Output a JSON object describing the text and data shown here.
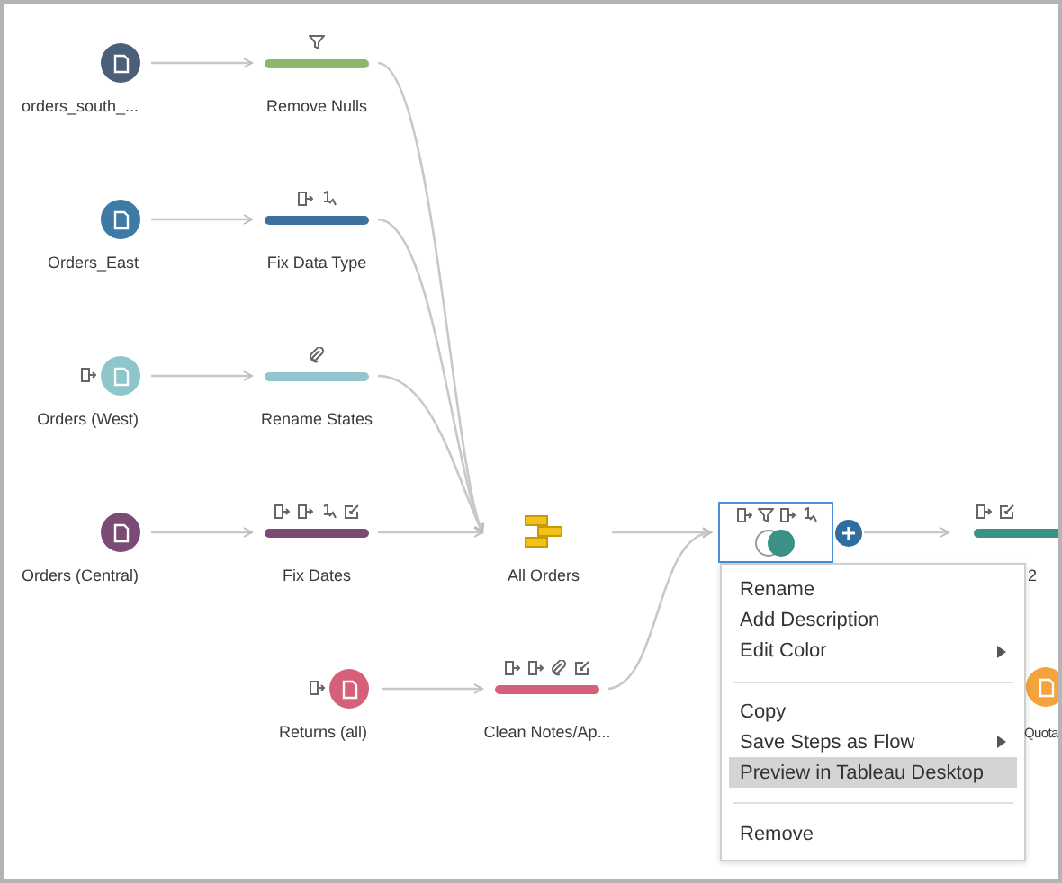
{
  "sources": [
    {
      "label": "orders_south_...",
      "color": "#4b5f78"
    },
    {
      "label": "Orders_East",
      "color": "#3d7aa6"
    },
    {
      "label": "Orders (West)",
      "color": "#8fc6cc"
    },
    {
      "label": "Orders (Central)",
      "color": "#7b4b76"
    },
    {
      "label": "Returns (all)",
      "color": "#d6607a"
    },
    {
      "label": "Quota",
      "color": "#f5a33c"
    }
  ],
  "steps": [
    {
      "label": "Remove Nulls",
      "color": "#8bb86b"
    },
    {
      "label": "Fix Data Type",
      "color": "#3d72a0"
    },
    {
      "label": "Rename States",
      "color": "#93c6cc"
    },
    {
      "label": "Fix Dates",
      "color": "#7b4b76"
    },
    {
      "label": "Clean Notes/Ap...",
      "color": "#d6607a"
    },
    {
      "label": "2",
      "color": "#3a9184"
    }
  ],
  "union": {
    "label": "All Orders"
  },
  "join": {
    "selected": true
  },
  "menu": {
    "groups": [
      [
        {
          "label": "Rename",
          "submenu": false,
          "selected": false
        },
        {
          "label": "Add Description",
          "submenu": false,
          "selected": false
        },
        {
          "label": "Edit Color",
          "submenu": true,
          "selected": false
        }
      ],
      [
        {
          "label": "Copy",
          "submenu": false,
          "selected": false
        },
        {
          "label": "Save Steps as Flow",
          "submenu": true,
          "selected": false
        },
        {
          "label": "Preview in Tableau Desktop",
          "submenu": false,
          "selected": true
        }
      ],
      [
        {
          "label": "Remove",
          "submenu": false,
          "selected": false
        }
      ]
    ]
  }
}
